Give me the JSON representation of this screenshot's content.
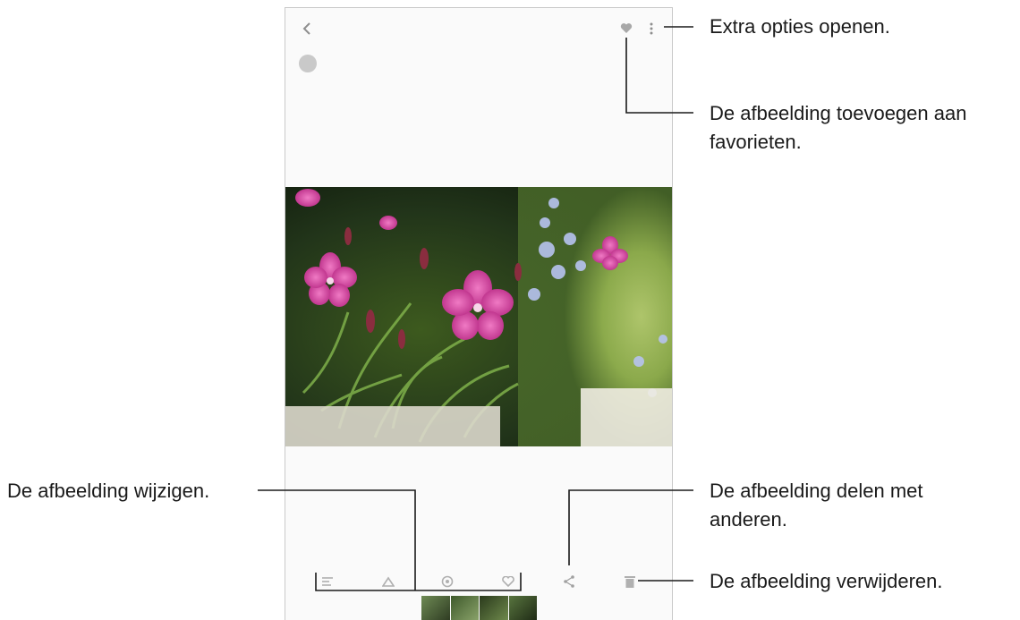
{
  "callouts": {
    "more_options": "Extra opties openen.",
    "favorite_line1": "De afbeelding toevoegen aan",
    "favorite_line2": "favorieten.",
    "edit": "De afbeelding wijzigen.",
    "share_line1": "De afbeelding delen met",
    "share_line2": "anderen.",
    "delete": "De afbeelding verwijderen."
  },
  "icons": {
    "top": [
      "back-icon",
      "favorite-heart-icon",
      "more-options-icon"
    ],
    "status": [
      "info-circle-icon"
    ],
    "bottom": [
      "adjust-icon",
      "edit-icon",
      "filter-icon",
      "favorite-icon",
      "share-icon",
      "delete-icon"
    ]
  },
  "colors": {
    "icon_gray": "#9a9a9a",
    "leader_line": "#1a1a1a",
    "flower_pink": "#cc3c9a"
  }
}
